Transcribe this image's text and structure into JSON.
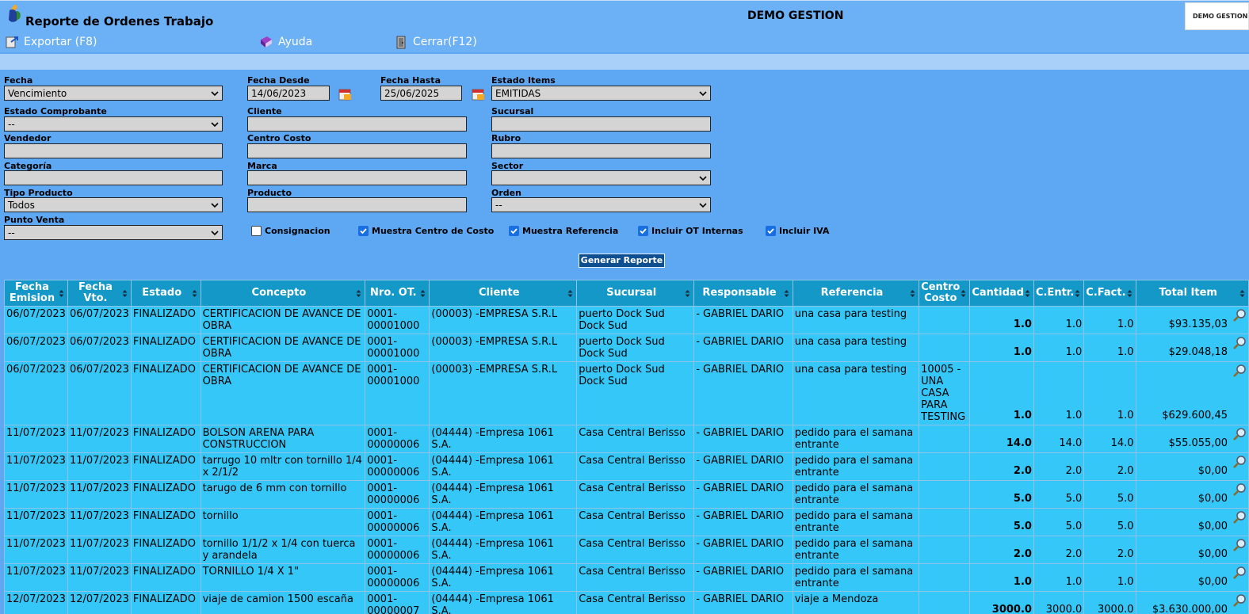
{
  "header": {
    "app_title": "Reporte de Ordenes Trabajo",
    "company": "DEMO GESTION",
    "company_logo_text": "DEMO GESTION"
  },
  "toolbar": {
    "export_label": "Exportar (F8)",
    "help_label": "Ayuda",
    "close_label": "Cerrar(F12)"
  },
  "filters": {
    "fecha_label": "Fecha",
    "fecha_value": "Vencimiento",
    "fecha_desde_label": "Fecha Desde",
    "fecha_desde_value": "14/06/2023",
    "fecha_hasta_label": "Fecha Hasta",
    "fecha_hasta_value": "25/06/2025",
    "estado_items_label": "Estado Items",
    "estado_items_value": "EMITIDAS",
    "estado_comprobante_label": "Estado Comprobante",
    "estado_comprobante_value": "--",
    "cliente_label": "Cliente",
    "cliente_value": "",
    "sucursal_label": "Sucursal",
    "sucursal_value": "",
    "vendedor_label": "Vendedor",
    "vendedor_value": "",
    "centro_costo_label": "Centro Costo",
    "centro_costo_value": "",
    "rubro_label": "Rubro",
    "rubro_value": "",
    "categoria_label": "Categoría",
    "categoria_value": "",
    "marca_label": "Marca",
    "marca_value": "",
    "sector_label": "Sector",
    "sector_value": "",
    "tipo_producto_label": "Tipo Producto",
    "tipo_producto_value": "Todos",
    "producto_label": "Producto",
    "producto_value": "",
    "orden_label": "Orden",
    "orden_value": "--",
    "punto_venta_label": "Punto Venta",
    "punto_venta_value": "--"
  },
  "checks": {
    "consignacion": "Consignacion",
    "centro_costo": "Muestra Centro de Costo",
    "referencia": "Muestra Referencia",
    "ot_internas": "Incluir OT Internas",
    "iva": "Incluir IVA"
  },
  "generate_label": "Generar Reporte",
  "table": {
    "headers": [
      "Fecha Emision",
      "Fecha Vto.",
      "Estado",
      "Concepto",
      "Nro. OT.",
      "Cliente",
      "Sucursal",
      "Responsable",
      "Referencia",
      "Centro Costo",
      "Cantidad",
      "C.Entr.",
      "C.Fact.",
      "Total Item"
    ],
    "rows": [
      [
        "06/07/2023",
        "06/07/2023",
        "FINALIZADO",
        "CERTIFICACION DE AVANCE DE OBRA",
        "0001-00001000",
        "(00003) -EMPRESA S.R.L",
        "puerto Dock Sud Dock Sud",
        "- GABRIEL DARIO",
        "una casa para testing",
        "",
        "1.0",
        "1.0",
        "1.0",
        "$93.135,03"
      ],
      [
        "06/07/2023",
        "06/07/2023",
        "FINALIZADO",
        "CERTIFICACION DE AVANCE DE OBRA",
        "0001-00001000",
        "(00003) -EMPRESA S.R.L",
        "puerto Dock Sud Dock Sud",
        "- GABRIEL DARIO",
        "una casa para testing",
        "",
        "1.0",
        "1.0",
        "1.0",
        "$29.048,18"
      ],
      [
        "06/07/2023",
        "06/07/2023",
        "FINALIZADO",
        "CERTIFICACION DE AVANCE DE OBRA",
        "0001-00001000",
        "(00003) -EMPRESA S.R.L",
        "puerto Dock Sud Dock Sud",
        "- GABRIEL DARIO",
        "una casa para testing",
        "10005 - UNA CASA PARA TESTING",
        "1.0",
        "1.0",
        "1.0",
        "$629.600,45"
      ],
      [
        "11/07/2023",
        "11/07/2023",
        "FINALIZADO",
        "BOLSON ARENA PARA CONSTRUCCION",
        "0001-00000006",
        "(04444) -Empresa 1061 S.A.",
        "Casa Central Berisso",
        "- GABRIEL DARIO",
        "pedido para el samana entrante",
        "",
        "14.0",
        "14.0",
        "14.0",
        "$55.055,00"
      ],
      [
        "11/07/2023",
        "11/07/2023",
        "FINALIZADO",
        "tarrugo 10 mltr con tornillo 1/4 x 2/1/2",
        "0001-00000006",
        "(04444) -Empresa 1061 S.A.",
        "Casa Central Berisso",
        "- GABRIEL DARIO",
        "pedido para el samana entrante",
        "",
        "2.0",
        "2.0",
        "2.0",
        "$0,00"
      ],
      [
        "11/07/2023",
        "11/07/2023",
        "FINALIZADO",
        "tarugo de 6 mm con tornillo",
        "0001-00000006",
        "(04444) -Empresa 1061 S.A.",
        "Casa Central Berisso",
        "- GABRIEL DARIO",
        "pedido para el samana entrante",
        "",
        "5.0",
        "5.0",
        "5.0",
        "$0,00"
      ],
      [
        "11/07/2023",
        "11/07/2023",
        "FINALIZADO",
        "tornillo",
        "0001-00000006",
        "(04444) -Empresa 1061 S.A.",
        "Casa Central Berisso",
        "- GABRIEL DARIO",
        "pedido para el samana entrante",
        "",
        "5.0",
        "5.0",
        "5.0",
        "$0,00"
      ],
      [
        "11/07/2023",
        "11/07/2023",
        "FINALIZADO",
        "tornillo 1/1/2 x 1/4 con tuerca y arandela",
        "0001-00000006",
        "(04444) -Empresa 1061 S.A.",
        "Casa Central Berisso",
        "- GABRIEL DARIO",
        "pedido para el samana entrante",
        "",
        "2.0",
        "2.0",
        "2.0",
        "$0,00"
      ],
      [
        "11/07/2023",
        "11/07/2023",
        "FINALIZADO",
        "TORNILLO 1/4 X 1\"",
        "0001-00000006",
        "(04444) -Empresa 1061 S.A.",
        "Casa Central Berisso",
        "- GABRIEL DARIO",
        "pedido para el samana entrante",
        "",
        "1.0",
        "1.0",
        "1.0",
        "$0,00"
      ],
      [
        "12/07/2023",
        "12/07/2023",
        "FINALIZADO",
        "viaje de camion 1500 escaña",
        "0001-00000007",
        "(04444) -Empresa 1061 S.A.",
        "Casa Central Berisso",
        "- GABRIEL DARIO",
        "viaje a Mendoza",
        "",
        "3000.0",
        "3000.0",
        "3000.0",
        "$3.630.000,00"
      ]
    ]
  }
}
